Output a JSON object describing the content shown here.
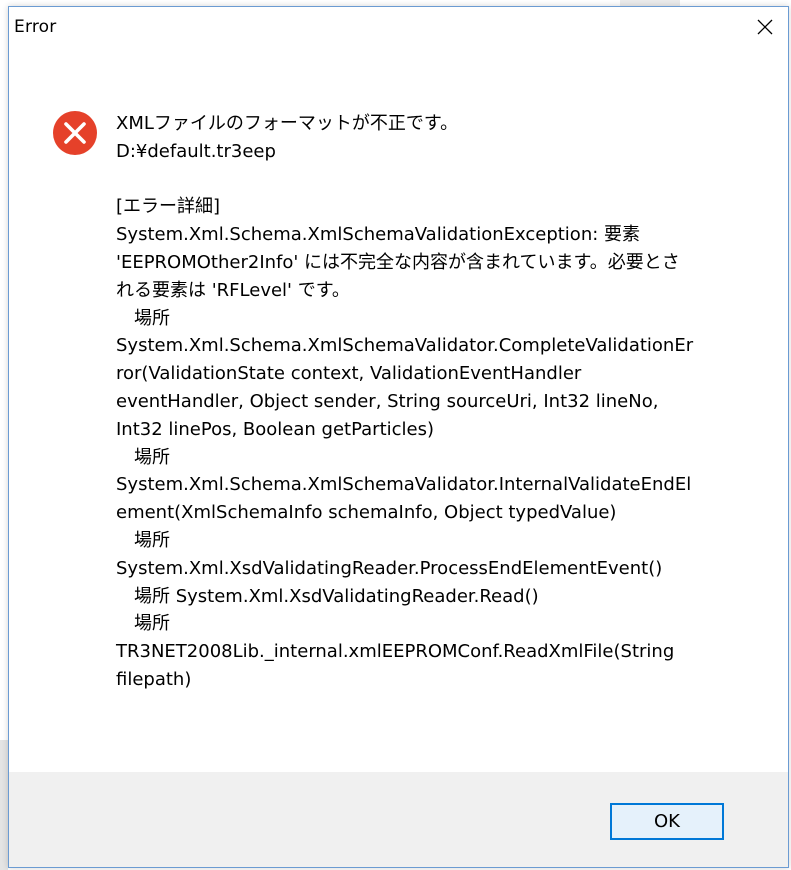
{
  "dialog": {
    "title": "Error",
    "close_icon": "close-icon",
    "error_icon": "error-icon",
    "colors": {
      "error_red": "#e5412a",
      "button_border": "#0078d7",
      "button_bg": "#e5f1fb",
      "footer_bg": "#f0f0f0"
    },
    "message": {
      "line1": "XMLファイルのフォーマットが不正です。",
      "line2": "D:¥default.tr3eep",
      "detail_header": "[エラー詳細]",
      "detail_lines": [
        "System.Xml.Schema.XmlSchemaValidationException: 要素",
        "'EEPROMOther2Info' には不完全な内容が含まれています。必要とさ",
        "れる要素は 'RFLevel' です。",
        "場所",
        "System.Xml.Schema.XmlSchemaValidator.CompleteValidationEr",
        "ror(ValidationState context, ValidationEventHandler",
        "eventHandler, Object sender, String sourceUri, Int32 lineNo,",
        "Int32 linePos, Boolean getParticles)",
        "場所",
        "System.Xml.Schema.XmlSchemaValidator.InternalValidateEndEl",
        "ement(XmlSchemaInfo schemaInfo, Object typedValue)",
        "場所",
        "System.Xml.XsdValidatingReader.ProcessEndElementEvent()",
        "場所 System.Xml.XsdValidatingReader.Read()",
        "場所",
        "TR3NET2008Lib._internal.xmlEEPROMConf.ReadXmlFile(String",
        "filepath)"
      ]
    },
    "ok_label": "OK"
  }
}
